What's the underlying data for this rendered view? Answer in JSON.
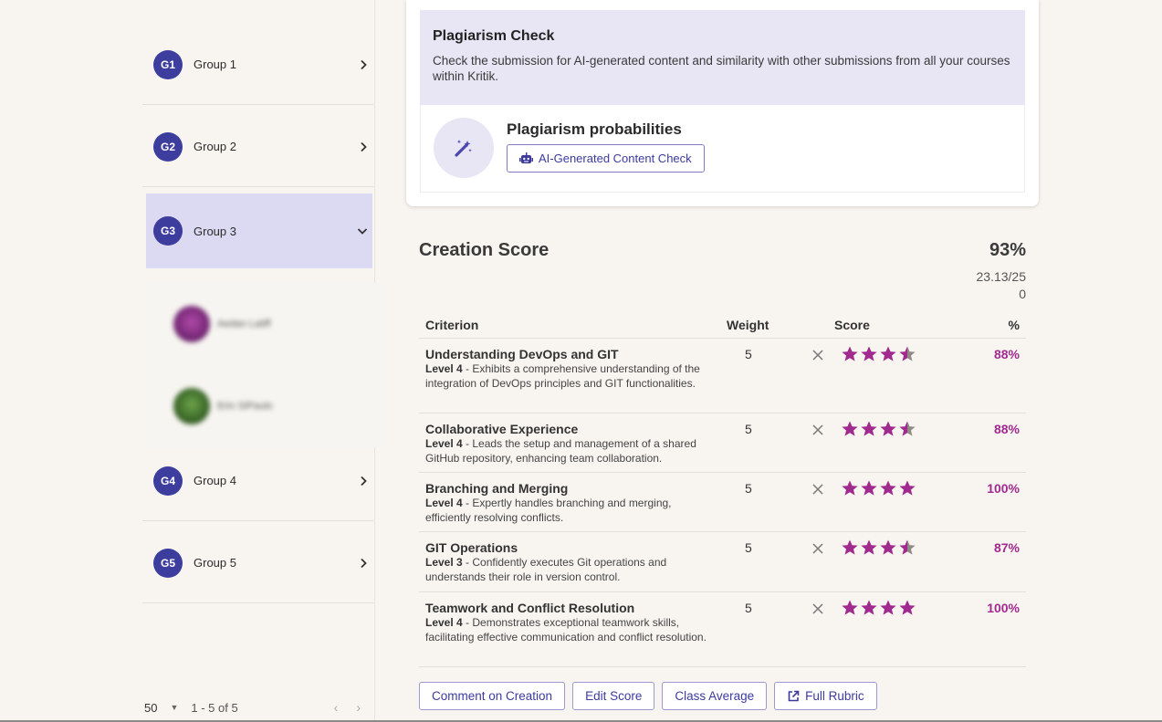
{
  "colors": {
    "accent": "#3d3d9e",
    "score_pink": "#a02a8e",
    "active_group_bg": "#dcdaf2"
  },
  "sidebar": {
    "groups": [
      {
        "badge": "G1",
        "label": "Group 1",
        "icon": "chevron-right-icon"
      },
      {
        "badge": "G2",
        "label": "Group 2",
        "icon": "chevron-right-icon"
      },
      {
        "badge": "G3",
        "label": "Group 3",
        "icon": "chevron-down-icon",
        "expanded": true
      },
      {
        "badge": "G4",
        "label": "Group 4",
        "icon": "chevron-right-icon"
      },
      {
        "badge": "G5",
        "label": "Group 5",
        "icon": "chevron-right-icon"
      }
    ],
    "members": [
      {
        "name": "Aedan Latiff",
        "avatar_color": "#7a2a7a"
      },
      {
        "name": "Erin SiPaulo",
        "avatar_color": "#3d6b2a"
      }
    ],
    "pager": {
      "page_size": "50",
      "range": "1 - 5 of 5"
    }
  },
  "plagiarism": {
    "title": "Plagiarism Check",
    "description": "Check the submission for AI-generated content and similarity with other submissions from all your courses within Kritik.",
    "probabilities_title": "Plagiarism probabilities",
    "ai_button": "AI-Generated Content Check"
  },
  "creation_score": {
    "title": "Creation Score",
    "percent": "93%",
    "raw_line1": "23.13/25",
    "raw_line2": "0",
    "headers": {
      "criterion": "Criterion",
      "weight": "Weight",
      "score": "Score",
      "pct": "%"
    },
    "rows": [
      {
        "name": "Understanding DevOps and GIT",
        "level": "Level 4",
        "desc": " - Exhibits a comprehensive understanding of the integration of DevOps principles and GIT functionalities.",
        "weight": "5",
        "stars": 3.5,
        "pct": "88%"
      },
      {
        "name": "Collaborative Experience",
        "level": "Level 4",
        "desc": " - Leads the setup and management of a shared GitHub repository, enhancing team collaboration.",
        "weight": "5",
        "stars": 3.5,
        "pct": "88%"
      },
      {
        "name": "Branching and Merging",
        "level": "Level 4",
        "desc": " - Expertly handles branching and merging, efficiently resolving conflicts.",
        "weight": "5",
        "stars": 4,
        "pct": "100%"
      },
      {
        "name": "GIT Operations",
        "level": "Level 3",
        "desc": " - Confidently executes Git operations and understands their role in version control.",
        "weight": "5",
        "stars": 3.5,
        "pct": "87%"
      },
      {
        "name": "Teamwork and Conflict Resolution",
        "level": "Level 4",
        "desc": " - Demonstrates exceptional teamwork skills, facilitating effective communication and conflict resolution.",
        "weight": "5",
        "stars": 4,
        "pct": "100%"
      }
    ],
    "actions": {
      "comment": "Comment on Creation",
      "edit": "Edit Score",
      "average": "Class Average",
      "rubric": "Full Rubric"
    }
  }
}
